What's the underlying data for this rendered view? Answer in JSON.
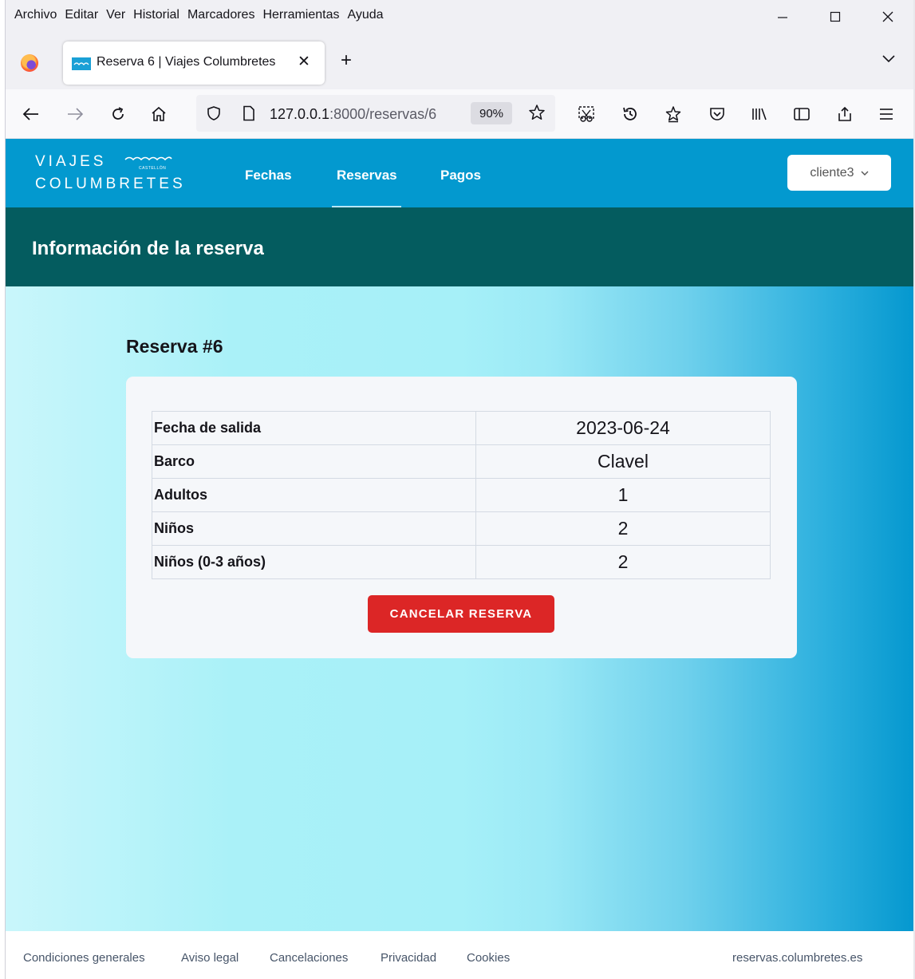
{
  "browser": {
    "menu": [
      "Archivo",
      "Editar",
      "Ver",
      "Historial",
      "Marcadores",
      "Herramientas",
      "Ayuda"
    ],
    "tab_title": "Reserva 6 | Viajes Columbretes",
    "url_host": "127.0.0.1",
    "url_path": ":8000/reservas/6",
    "zoom": "90%",
    "icons": [
      "back-icon",
      "forward-icon",
      "reload-icon",
      "home-icon",
      "shield-icon",
      "page-icon",
      "bookmark-star-icon",
      "screenshot-icon",
      "history-icon",
      "extensions-icon",
      "pocket-icon",
      "library-icon",
      "sidebar-icon",
      "share-icon",
      "menu-icon"
    ]
  },
  "site": {
    "logo_line1": "VIAJES",
    "logo_line2": "COLUMBRETES",
    "logo_small": "CASTELLÓN",
    "nav": [
      "Fechas",
      "Reservas",
      "Pagos"
    ],
    "active_nav": "Reservas",
    "user": "cliente3",
    "brand_color": "#0399cf"
  },
  "page": {
    "heading": "Información de la reserva",
    "reservation_title": "Reserva #6",
    "rows": [
      {
        "label": "Fecha de salida",
        "value": "2023-06-24"
      },
      {
        "label": "Barco",
        "value": "Clavel"
      },
      {
        "label": "Adultos",
        "value": "1"
      },
      {
        "label": "Niños",
        "value": "2"
      },
      {
        "label": "Niños (0-3 años)",
        "value": "2"
      }
    ],
    "cancel_label": "CANCELAR RESERVA",
    "cancel_color": "#dc2626"
  },
  "footer": {
    "links": [
      "Condiciones generales",
      "Aviso legal",
      "Cancelaciones",
      "Privacidad",
      "Cookies"
    ],
    "domain": "reservas.columbretes.es"
  }
}
